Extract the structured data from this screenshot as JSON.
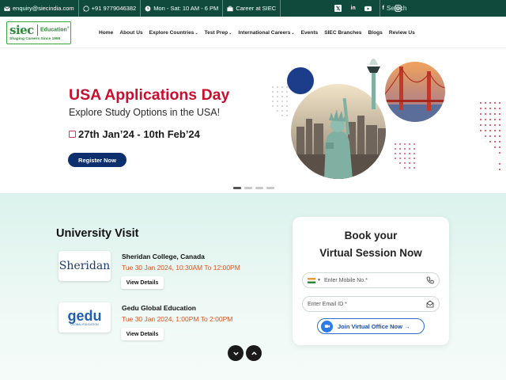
{
  "topbar": {
    "email": "enquiry@siecindia.com",
    "phone": "+91 9779046382",
    "hours": "Mon - Sat: 10 AM - 6 PM",
    "career": "Career at SIEC",
    "search_placeholder": "Search",
    "social": [
      "x-icon",
      "linkedin-icon",
      "youtube-icon",
      "facebook-icon",
      "instagram-icon"
    ]
  },
  "logo": {
    "brand": "siec",
    "suffix": "Education",
    "tagline": "Shaping Careers Since 1995"
  },
  "nav": {
    "items": [
      {
        "label": "Home",
        "dropdown": false
      },
      {
        "label": "About Us",
        "dropdown": false
      },
      {
        "label": "Explore Countries",
        "dropdown": true
      },
      {
        "label": "Test Prep",
        "dropdown": true
      },
      {
        "label": "International Careers",
        "dropdown": true
      },
      {
        "label": "Events",
        "dropdown": false
      },
      {
        "label": "SIEC Branches",
        "dropdown": false
      },
      {
        "label": "Blogs",
        "dropdown": false
      },
      {
        "label": "Review Us",
        "dropdown": false
      }
    ]
  },
  "hero": {
    "title": "USA Applications Day",
    "subtitle": "Explore Study Options in the USA!",
    "dates": "27th Jan’24 - 10th Feb’24",
    "button": "Register Now",
    "slides_total": 4,
    "active_slide": 1
  },
  "university_visit": {
    "title": "University Visit",
    "items": [
      {
        "logo_text": "Sheridan",
        "name": "Sheridan College, Canada",
        "date": "Tue 30 Jan 2024, 10:30AM To 12:00PM",
        "button": "View Details"
      },
      {
        "logo_text": "gedu",
        "logo_sub": "GLOBAL EDUCATION",
        "name": "Gedu Global Education",
        "date": "Tue 30 Jan 2024, 1:00PM To 2:00PM",
        "button": "View Details"
      }
    ]
  },
  "booking": {
    "title_line1": "Book your",
    "title_line2": "Virtual Session Now",
    "mobile_placeholder": "Enter Mobile No.*",
    "email_placeholder": "Enter Email ID *",
    "join_button": "Join Virtual Office Now →"
  },
  "colors": {
    "topbar": "#0f4a3c",
    "accent_red": "#c8102e",
    "button_navy": "#0e2f6e",
    "date_orange": "#d9541e",
    "section_bg": "#dbf2ec"
  }
}
